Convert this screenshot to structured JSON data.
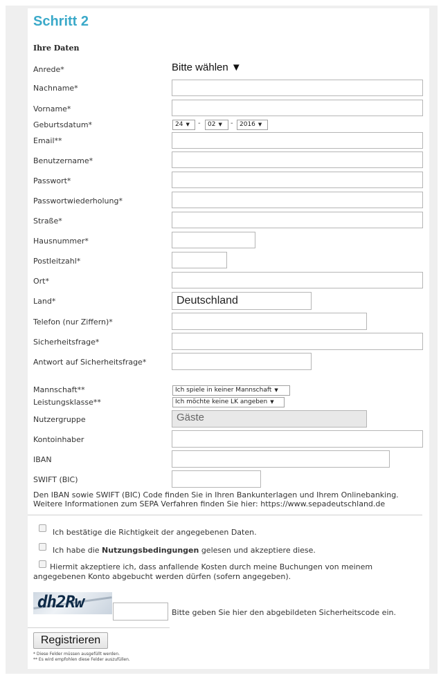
{
  "header": {
    "title": "Schritt 2",
    "section": "Ihre Daten"
  },
  "fields": {
    "anrede": {
      "label": "Anrede*",
      "value": "Bitte wählen ▼"
    },
    "nachname": {
      "label": "Nachname*",
      "value": ""
    },
    "vorname": {
      "label": "Vorname*",
      "value": ""
    },
    "geburtsdatum": {
      "label": "Geburtsdatum*",
      "day": "24",
      "month": "02",
      "year": "2016",
      "sep": "-"
    },
    "email": {
      "label": "Email**",
      "value": ""
    },
    "benutzername": {
      "label": "Benutzername*",
      "value": ""
    },
    "passwort": {
      "label": "Passwort*",
      "value": ""
    },
    "passwort2": {
      "label": "Passwortwiederholung*",
      "value": ""
    },
    "strasse": {
      "label": "Straße*",
      "value": ""
    },
    "hausnummer": {
      "label": "Hausnummer*",
      "value": ""
    },
    "plz": {
      "label": "Postleitzahl*",
      "value": ""
    },
    "ort": {
      "label": "Ort*",
      "value": ""
    },
    "land": {
      "label": "Land*",
      "value": "Deutschland"
    },
    "telefon": {
      "label": "Telefon (nur Ziffern)*",
      "value": ""
    },
    "frage": {
      "label": "Sicherheitsfrage*",
      "value": ""
    },
    "antwort": {
      "label": "Antwort auf Sicherheitsfrage*",
      "value": ""
    },
    "mannschaft": {
      "label": "Mannschaft**",
      "value": "Ich spiele in keiner Mannschaft"
    },
    "leistungsklasse": {
      "label": "Leistungsklasse**",
      "value": "Ich möchte keine LK angeben"
    },
    "nutzergruppe": {
      "label": "Nutzergruppe",
      "value": "Gäste"
    },
    "kontoinhaber": {
      "label": "Kontoinhaber",
      "value": ""
    },
    "iban": {
      "label": "IBAN",
      "value": ""
    },
    "swift": {
      "label": "SWIFT (BIC)",
      "value": ""
    }
  },
  "info": {
    "line1": "Den IBAN sowie SWIFT (BIC) Code finden Sie in Ihren Bankunterlagen und Ihrem Onlinebanking.",
    "line2": "Weitere Informationen zum SEPA Verfahren finden Sie hier: https://www.sepadeutschland.de"
  },
  "checks": {
    "c1": "Ich bestätige die Richtigkeit der angegebenen Daten.",
    "c2_pre": "Ich habe die ",
    "c2_bold": "Nutzungsbedingungen",
    "c2_post": " gelesen und akzeptiere diese.",
    "c3_line1": "Hiermit akzeptiere ich, dass anfallende Kosten durch meine Buchungen von meinem",
    "c3_line2": "angegebenen Konto abgebucht werden dürfen (sofern angegeben)."
  },
  "captcha": {
    "code": "dh2Rw",
    "value": "",
    "hint": "Bitte geben Sie hier den abgebildeten Sicherheitscode ein."
  },
  "submit": {
    "label": "Registrieren"
  },
  "footnotes": {
    "f1": "* Diese Felder müssen ausgefüllt werden.",
    "f2": "** Es wird empfohlen diese Felder auszufüllen."
  }
}
